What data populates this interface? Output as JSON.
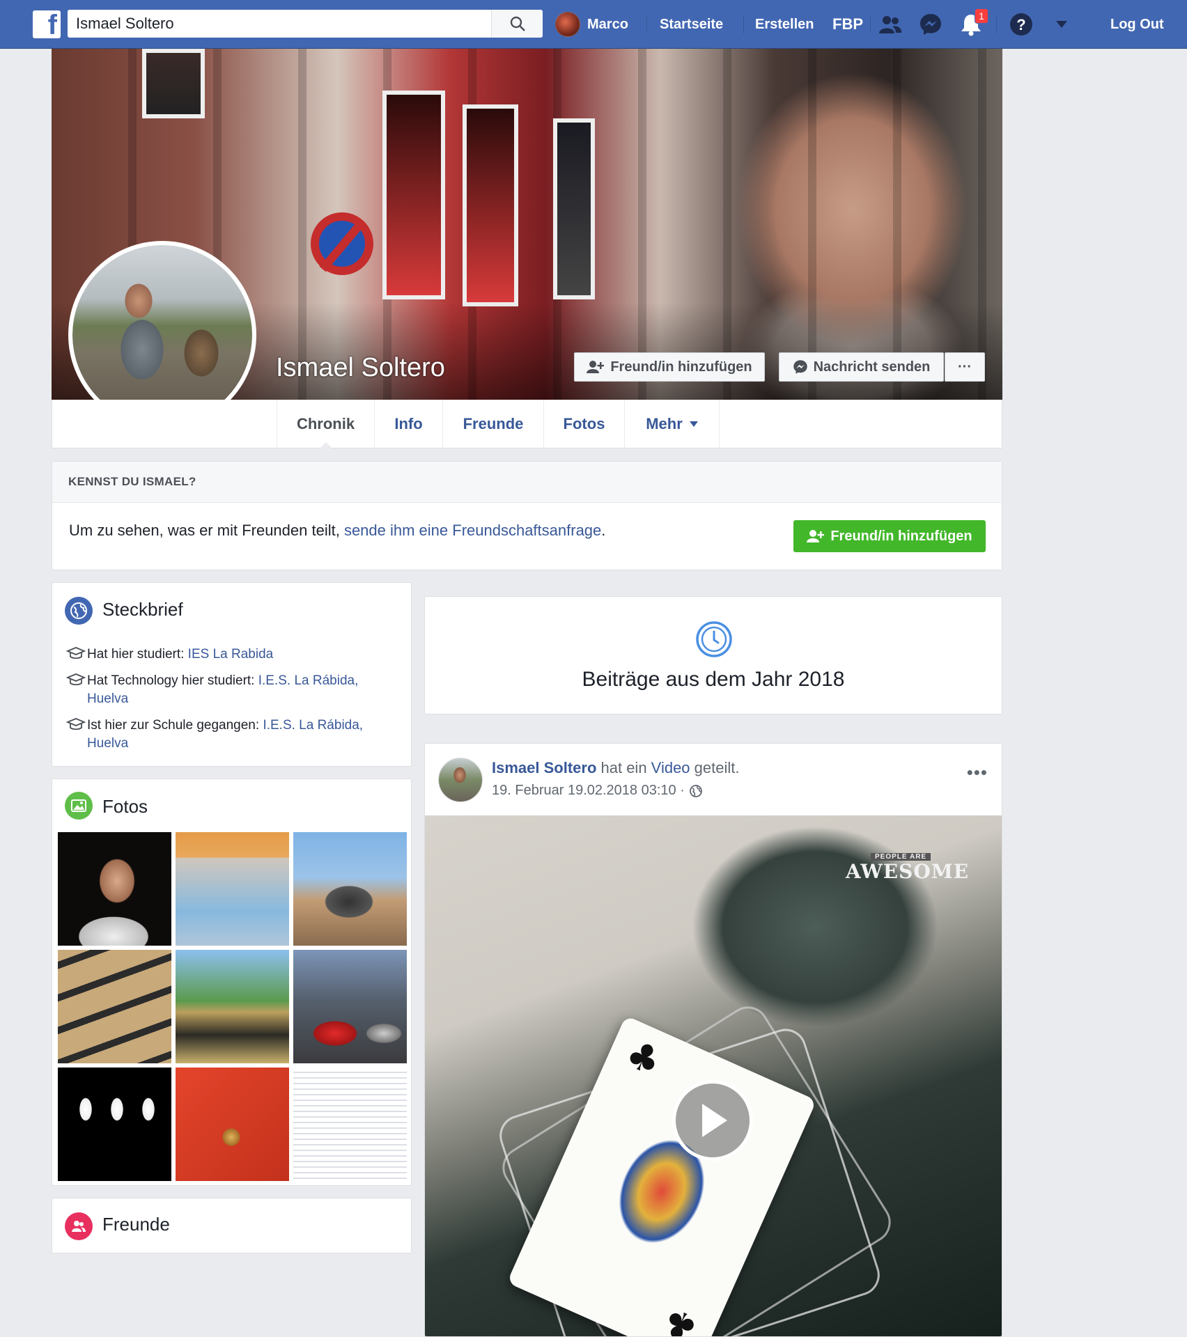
{
  "topbar": {
    "search_value": "Ismael Soltero",
    "user_name": "Marco",
    "home": "Startseite",
    "create": "Erstellen",
    "fbp": "FBP",
    "notification_count": "1",
    "logout": "Log Out"
  },
  "profile": {
    "name": "Ismael Soltero",
    "add_friend": "Freund/in hinzufügen",
    "send_message": "Nachricht senden",
    "more": "···"
  },
  "tabs": [
    {
      "label": "Chronik"
    },
    {
      "label": "Info"
    },
    {
      "label": "Freunde"
    },
    {
      "label": "Fotos"
    },
    {
      "label": "Mehr"
    }
  ],
  "know": {
    "title": "KENNST DU ISMAEL?",
    "text_before": "Um zu sehen, was er mit Freunden teilt, ",
    "text_link": "sende ihm eine Freundschaftsanfrage",
    "text_after": ".",
    "button": "Freund/in hinzufügen"
  },
  "intro": {
    "title": "Steckbrief",
    "items": [
      {
        "prefix": "Hat hier studiert: ",
        "link": "IES La Rabida"
      },
      {
        "prefix": "Hat Technology hier studiert: ",
        "link": "I.E.S. La Rábida, Huelva"
      },
      {
        "prefix": "Ist hier zur Schule gegangen: ",
        "link": "I.E.S. La Rábida, Huelva"
      }
    ]
  },
  "photos": {
    "title": "Fotos"
  },
  "friends": {
    "title": "Freunde"
  },
  "year": {
    "title": "Beiträge aus dem Jahr 2018"
  },
  "post": {
    "author": "Ismael Soltero",
    "action": " hat ein ",
    "object": "Video",
    "suffix": " geteilt.",
    "time": "19. Februar 19.02.2018 03:10 ·",
    "more": "•••",
    "watermark_top": "PEOPLE ARE",
    "watermark": "AWESOME"
  },
  "colors": {
    "fb_blue": "#4267b2",
    "link": "#385898",
    "green": "#42b72a",
    "notification": "#fa3e3e"
  }
}
